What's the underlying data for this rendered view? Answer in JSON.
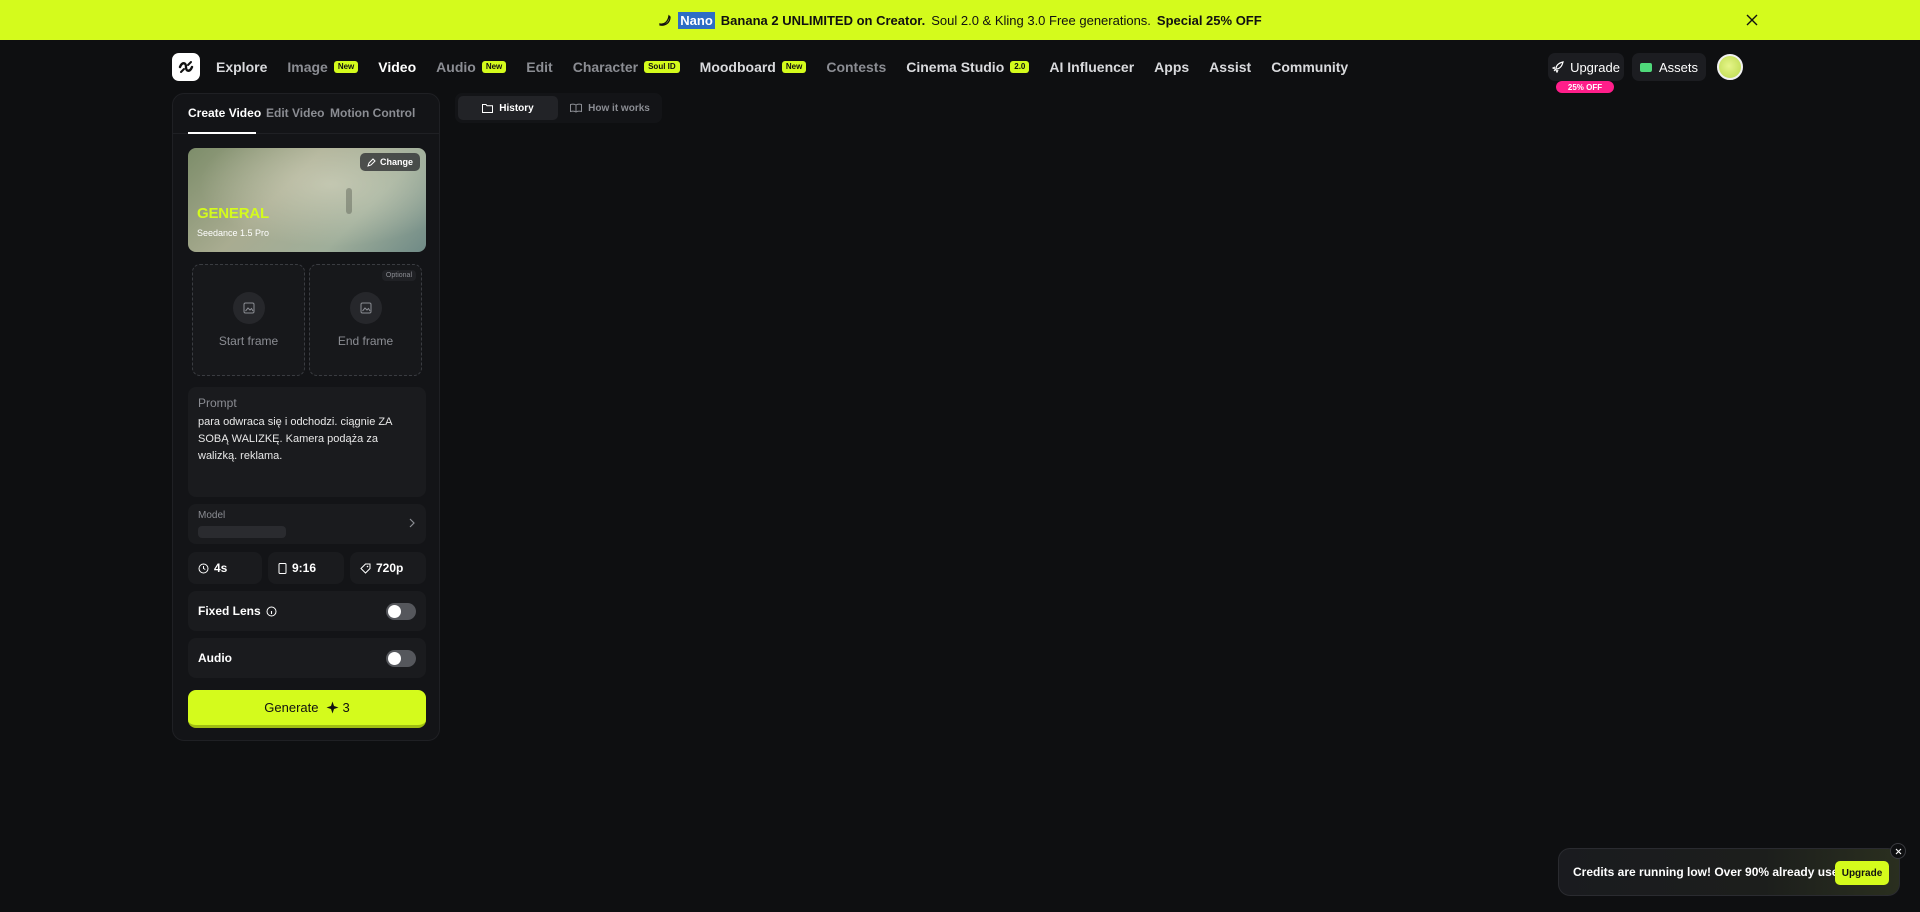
{
  "banner": {
    "highlight": "Nano",
    "bold": "Banana 2 UNLIMITED on Creator.",
    "regular": "Soul 2.0 & Kling 3.0 Free generations.",
    "offer": "Special 25% OFF"
  },
  "nav": {
    "items": [
      {
        "label": "Explore",
        "badge": ""
      },
      {
        "label": "Image",
        "badge": "New"
      },
      {
        "label": "Video",
        "badge": ""
      },
      {
        "label": "Audio",
        "badge": "New"
      },
      {
        "label": "Edit",
        "badge": ""
      },
      {
        "label": "Character",
        "badge": "Soul ID"
      },
      {
        "label": "Moodboard",
        "badge": "New"
      },
      {
        "label": "Contests",
        "badge": ""
      },
      {
        "label": "Cinema Studio",
        "badge": "2.0"
      },
      {
        "label": "AI Influencer",
        "badge": ""
      },
      {
        "label": "Apps",
        "badge": ""
      },
      {
        "label": "Assist",
        "badge": ""
      },
      {
        "label": "Community",
        "badge": ""
      }
    ],
    "upgrade_label": "Upgrade",
    "upgrade_badge": "25% OFF",
    "assets_label": "Assets"
  },
  "panel": {
    "tabs": [
      "Create Video",
      "Edit Video",
      "Motion Control"
    ],
    "hero": {
      "title": "GENERAL",
      "subtitle": "Seedance 1.5 Pro",
      "change_label": "Change"
    },
    "start_frame_label": "Start frame",
    "end_frame_label": "End frame",
    "optional_label": "Optional",
    "prompt_label": "Prompt",
    "prompt_text": "para odwraca się i odchodzi. ciągnie ZA SOBĄ WALIZKĘ. Kamera podąża za walizką. reklama.",
    "model_label": "Model",
    "duration": "4s",
    "aspect": "9:16",
    "resolution": "720p",
    "fixed_lens_label": "Fixed Lens",
    "fixed_lens_on": false,
    "audio_label": "Audio",
    "audio_on": false,
    "generate_label": "Generate",
    "generate_cost": "3"
  },
  "history_tabs": {
    "history_label": "History",
    "how_label": "How it works"
  },
  "toast": {
    "message": "Credits are running low! Over 90% already used",
    "button_label": "Upgrade"
  },
  "colors": {
    "accent": "#d4fb1c",
    "background": "#0e0f11",
    "badge_pink": "#ff1e8a"
  }
}
